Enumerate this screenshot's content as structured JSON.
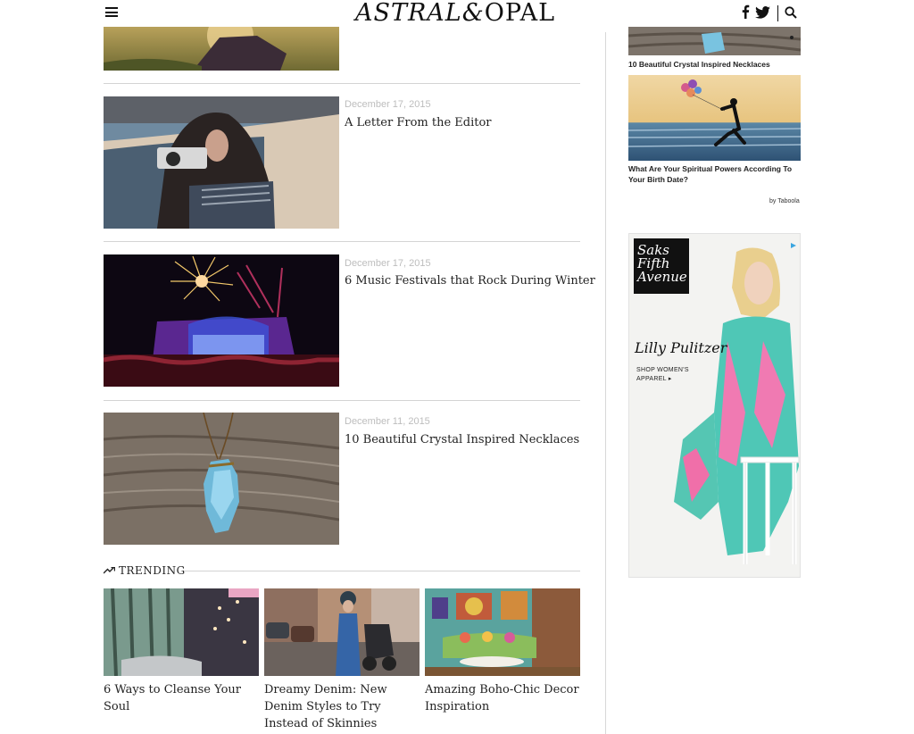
{
  "header": {
    "logo_main": "ASTRAL&",
    "logo_tail": "OPAL",
    "menu_icon": "hamburger-icon",
    "social_icons": [
      "facebook-icon",
      "twitter-icon",
      "search-icon"
    ]
  },
  "articles": [
    {
      "date": "December 17, 2015",
      "title": "A Letter From the Editor"
    },
    {
      "date": "December 17, 2015",
      "title": "6 Music Festivals that Rock During Winter"
    },
    {
      "date": "December 11, 2015",
      "title": "10 Beautiful Crystal Inspired Necklaces"
    }
  ],
  "trending": {
    "label": "TRENDING",
    "icon": "trend-arrow-icon",
    "items": [
      {
        "title": "6 Ways to Cleanse Your Soul"
      },
      {
        "title": "Dreamy Denim: New Denim Styles to Try Instead of Skinnies"
      },
      {
        "title": "Amazing Boho-Chic Decor Inspiration"
      }
    ]
  },
  "sidebar": {
    "recs": [
      {
        "caption": "10 Beautiful Crystal Inspired Necklaces"
      },
      {
        "caption": "What Are Your Spiritual Powers According To Your Birth Date?"
      }
    ],
    "taboola": "by Taboola",
    "ad": {
      "logo_text": "Saks Fifth Avenue",
      "brand": "Lilly Pulitzer",
      "cta": "SHOP WOMEN'S APPAREL ▸"
    }
  },
  "colors": {
    "text": "#222222",
    "date": "#bdbdbd",
    "divider": "#d4d4d4"
  }
}
